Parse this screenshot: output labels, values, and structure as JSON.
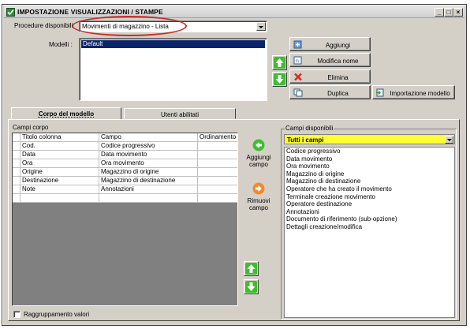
{
  "window": {
    "title": "IMPOSTAZIONE VISUALIZZAZIONI / STAMPE"
  },
  "procedure": {
    "label": "Procedure disponibili",
    "value": "Movimenti di magazzino - Lista"
  },
  "models": {
    "label": "Modelli :",
    "items": [
      "Default"
    ]
  },
  "model_buttons": {
    "add": "Aggiungi",
    "rename": "Modifica nome",
    "delete": "Elimina",
    "duplicate": "Duplica",
    "import": "Importazione modello"
  },
  "tabs": [
    {
      "label": "Corpo del modello",
      "active": true
    },
    {
      "label": "Utenti abilitati",
      "active": false
    }
  ],
  "body_fields": {
    "label": "Campi corpo",
    "columns": [
      "Titolo colonna",
      "Campo",
      "Ordinamento"
    ],
    "rows": [
      [
        "Cod.",
        "Codice progressivo",
        ""
      ],
      [
        "Data",
        "Data movimento",
        ""
      ],
      [
        "Ora",
        "Ora movimento",
        ""
      ],
      [
        "Origine",
        "Magazzino di origine",
        ""
      ],
      [
        "Destinazione",
        "Magazzino di destinazione",
        ""
      ],
      [
        "Note",
        "Annotazioni",
        ""
      ]
    ]
  },
  "field_actions": {
    "add": "Aggiungi campo",
    "remove": "Rimuovi campo"
  },
  "available_fields": {
    "label": "Campi disponibili",
    "filter_value": "Tutti i campi",
    "items": [
      "Codice progressivo",
      "Data movimento",
      "Ora movimento",
      "Magazzino di origine",
      "Magazzino di destinazione",
      "Operatore che ha creato il movimento",
      "Terminale creazione movimento",
      "Operatore destinazione",
      "Annotazioni",
      "Documento di riferimento (sub-opzione)",
      "Dettagli creazione/modifica"
    ]
  },
  "grouping": {
    "label": "Raggruppamento valori",
    "checked": false
  },
  "colors": {
    "window_bg": "#d4d0c8",
    "selection": "#0a246a",
    "filter_bg": "#ffff33",
    "highlight_oval": "#c0302a",
    "arrow_green": "#3cbf2e"
  }
}
